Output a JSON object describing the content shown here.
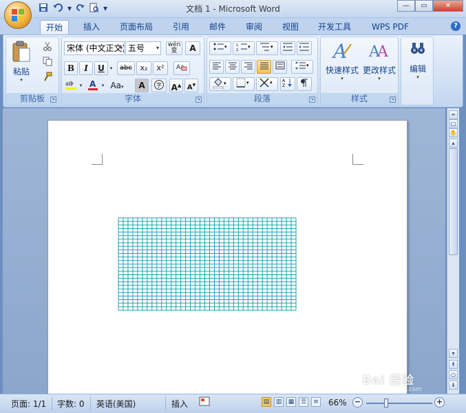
{
  "window": {
    "title": "文档 1 - Microsoft Word"
  },
  "tabs": [
    {
      "label": "开始"
    },
    {
      "label": "插入"
    },
    {
      "label": "页面布局"
    },
    {
      "label": "引用"
    },
    {
      "label": "邮件"
    },
    {
      "label": "审阅"
    },
    {
      "label": "视图"
    },
    {
      "label": "开发工具"
    },
    {
      "label": "WPS PDF"
    }
  ],
  "ribbon": {
    "clipboard": {
      "label": "剪贴板",
      "paste": "粘贴"
    },
    "font": {
      "label": "字体",
      "font_name": "宋体 (中文正文)",
      "font_size": "五号",
      "bold": "B",
      "italic": "I",
      "underline": "U",
      "strike": "abc",
      "subscript": "x₂",
      "superscript": "x²",
      "change_case": "Aa",
      "char_shade": "A",
      "grow": "A",
      "shrink": "A",
      "phonetic": "wén",
      "encircle": "字"
    },
    "paragraph": {
      "label": "段落"
    },
    "styles": {
      "label": "样式",
      "quick_styles": "快速样式",
      "change_styles": "更改样式"
    },
    "editing": {
      "label": "编辑"
    }
  },
  "grid_table": {
    "rows": 26,
    "cols": 37,
    "color": "#1aa3b8"
  },
  "statusbar": {
    "page": "页面: 1/1",
    "words": "字数: 0",
    "language": "英语(美国)",
    "mode": "插入",
    "zoom": "66%"
  },
  "watermark": {
    "text": "Bai 经验",
    "sub": "jingyan.baidu.com"
  },
  "colors": {
    "ribbon_bg": "#dce8f7",
    "accent": "#15428b",
    "title_bg": "#c4d7ef"
  }
}
